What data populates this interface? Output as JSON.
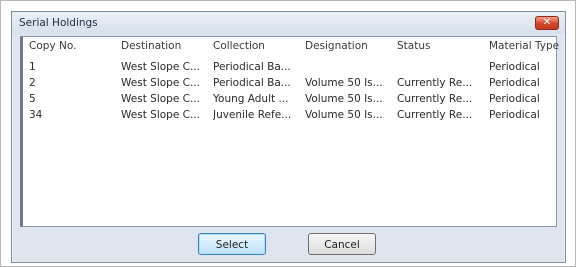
{
  "dialog": {
    "title": "Serial Holdings",
    "close_label": "✕"
  },
  "table": {
    "columns": [
      "Copy No.",
      "Destination",
      "Collection",
      "Designation",
      "Status",
      "Material Type"
    ],
    "rows": [
      [
        "1",
        "West Slope C...",
        "Periodical Ba...",
        "",
        "",
        "Periodical"
      ],
      [
        "2",
        "West Slope C...",
        "Periodical Ba...",
        "Volume 50 Is...",
        "Currently Re...",
        "Periodical"
      ],
      [
        "5",
        "West Slope C...",
        "Young Adult ...",
        "Volume 50 Is...",
        "Currently Re...",
        "Periodical"
      ],
      [
        "34",
        "West Slope C...",
        "Juvenile Refe...",
        "Volume 50 Is...",
        "Currently Re...",
        "Periodical"
      ]
    ]
  },
  "buttons": {
    "select_label": "Select",
    "cancel_label": "Cancel"
  }
}
